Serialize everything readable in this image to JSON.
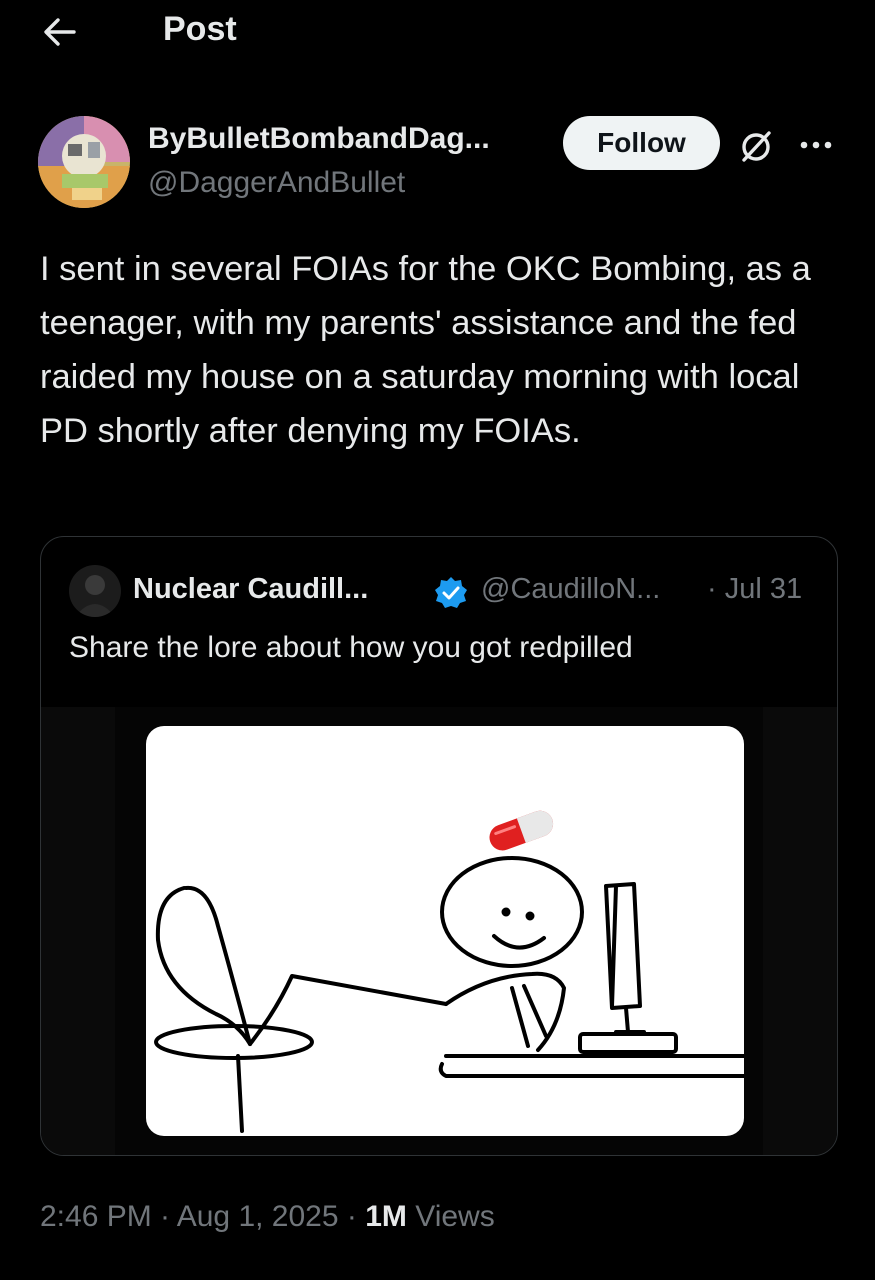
{
  "header": {
    "title": "Post",
    "back_icon": "arrow-left-icon"
  },
  "author": {
    "name": "ByBulletBombandDag...",
    "handle": "@DaggerAndBullet",
    "follow_label": "Follow"
  },
  "post": {
    "text": "I sent in several FOIAs for the OKC Bombing, as a teenager, with my parents' assistance and the fed raided my house on a saturday morning with local PD shortly after denying my FOIAs."
  },
  "quote": {
    "name": "Nuclear Caudill...",
    "handle": "@CaudilloN...",
    "date": "· Jul 31",
    "text": "Share the lore about how you got redpilled",
    "verified_color": "#1d9bf0"
  },
  "meta": {
    "time": "2:46 PM · Aug 1, 2025 · ",
    "views_count": "1M",
    "views_label": " Views"
  },
  "colors": {
    "background": "#000000",
    "text": "#e7e9ea",
    "muted": "#71767b",
    "border": "#2f3336",
    "follow_bg": "#eff3f4"
  }
}
